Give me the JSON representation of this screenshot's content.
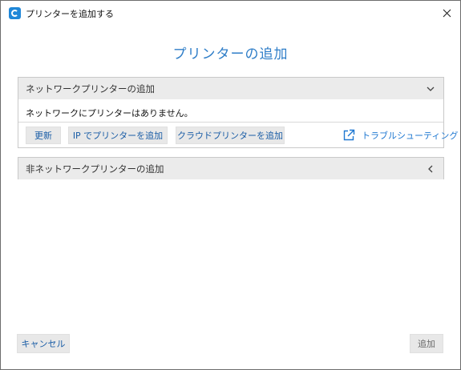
{
  "window": {
    "title": "プリンターを追加する",
    "close_glyph": "✕"
  },
  "heading": "プリンターの追加",
  "network_section": {
    "title": "ネットワークプリンターの追加",
    "expanded": true,
    "empty_message": "ネットワークにプリンターはありません。",
    "buttons": {
      "refresh": "更新",
      "add_by_ip": "IP でプリンターを追加",
      "add_cloud": "クラウドプリンターを追加"
    },
    "troubleshoot_label": "トラブルシューティング"
  },
  "non_network_section": {
    "title": "非ネットワークプリンターの追加",
    "expanded": false
  },
  "footer": {
    "cancel": "キャンセル",
    "add": "追加"
  },
  "colors": {
    "accent": "#2f7ec8",
    "link": "#1f78d1",
    "button_bg": "#e8e8e8",
    "section_header_bg": "#ebebeb"
  }
}
